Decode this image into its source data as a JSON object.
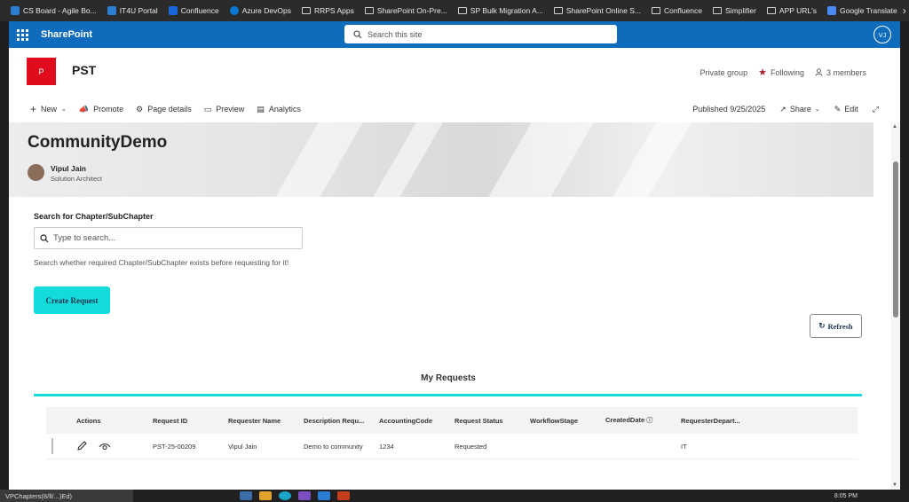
{
  "bookmarks": [
    {
      "label": "CS Board - Agile Bo...",
      "icon": "jira-icon"
    },
    {
      "label": "IT4U Portal",
      "icon": "page-icon"
    },
    {
      "label": "Confluence",
      "icon": "confluence-icon"
    },
    {
      "label": "Azure DevOps",
      "icon": "azure-devops-icon"
    },
    {
      "label": "RRPS Apps",
      "icon": "folder-icon"
    },
    {
      "label": "SharePoint On-Pre...",
      "icon": "folder-icon"
    },
    {
      "label": "SP Bulk Migration A...",
      "icon": "folder-icon"
    },
    {
      "label": "SharePoint Online S...",
      "icon": "folder-icon"
    },
    {
      "label": "Confluence",
      "icon": "folder-icon"
    },
    {
      "label": "Simplifier",
      "icon": "folder-icon"
    },
    {
      "label": "APP URL's",
      "icon": "folder-icon"
    },
    {
      "label": "Google Translate",
      "icon": "google-translate-icon"
    }
  ],
  "suitebar": {
    "app_name": "SharePoint",
    "search_placeholder": "Search this site",
    "user_initials": "VJ",
    "brand_color": "#0f6cbd"
  },
  "site": {
    "logo_letter": "P",
    "name": "PST",
    "privacy": "Private group",
    "following": "Following",
    "members": "3 members"
  },
  "commandbar": {
    "new": "New",
    "promote": "Promote",
    "page_details": "Page details",
    "preview": "Preview",
    "analytics": "Analytics",
    "published": "Published 9/25/2025",
    "share": "Share",
    "edit": "Edit"
  },
  "banner": {
    "title": "CommunityDemo",
    "author_name": "Vipul Jain",
    "author_role": "Solution Architect"
  },
  "search": {
    "label": "Search for Chapter/SubChapter",
    "placeholder": "Type to search...",
    "help": "Search whether required Chapter/SubChapter exists before requesting for it!"
  },
  "buttons": {
    "create": "Create Request",
    "refresh": "Refresh",
    "accent_color": "#14dbdb"
  },
  "requests": {
    "title": "My Requests",
    "columns": [
      "Actions",
      "Request ID",
      "Requester Name",
      "Description Requ...",
      "AccountingCode",
      "Request Status",
      "WorkflowStage",
      "CreatedDate",
      "RequesterDepart..."
    ],
    "rows": [
      {
        "request_id": "PST-25-00209",
        "requester": "Vipul Jain",
        "description": "Demo to community",
        "accounting_code": "1234",
        "status": "Requested",
        "workflow_stage": "",
        "created_date": "",
        "department": "IT"
      }
    ]
  },
  "taskbar": {
    "window_label": "VPChapters(8/ll/...)Ed)",
    "time": "8:05 PM"
  }
}
